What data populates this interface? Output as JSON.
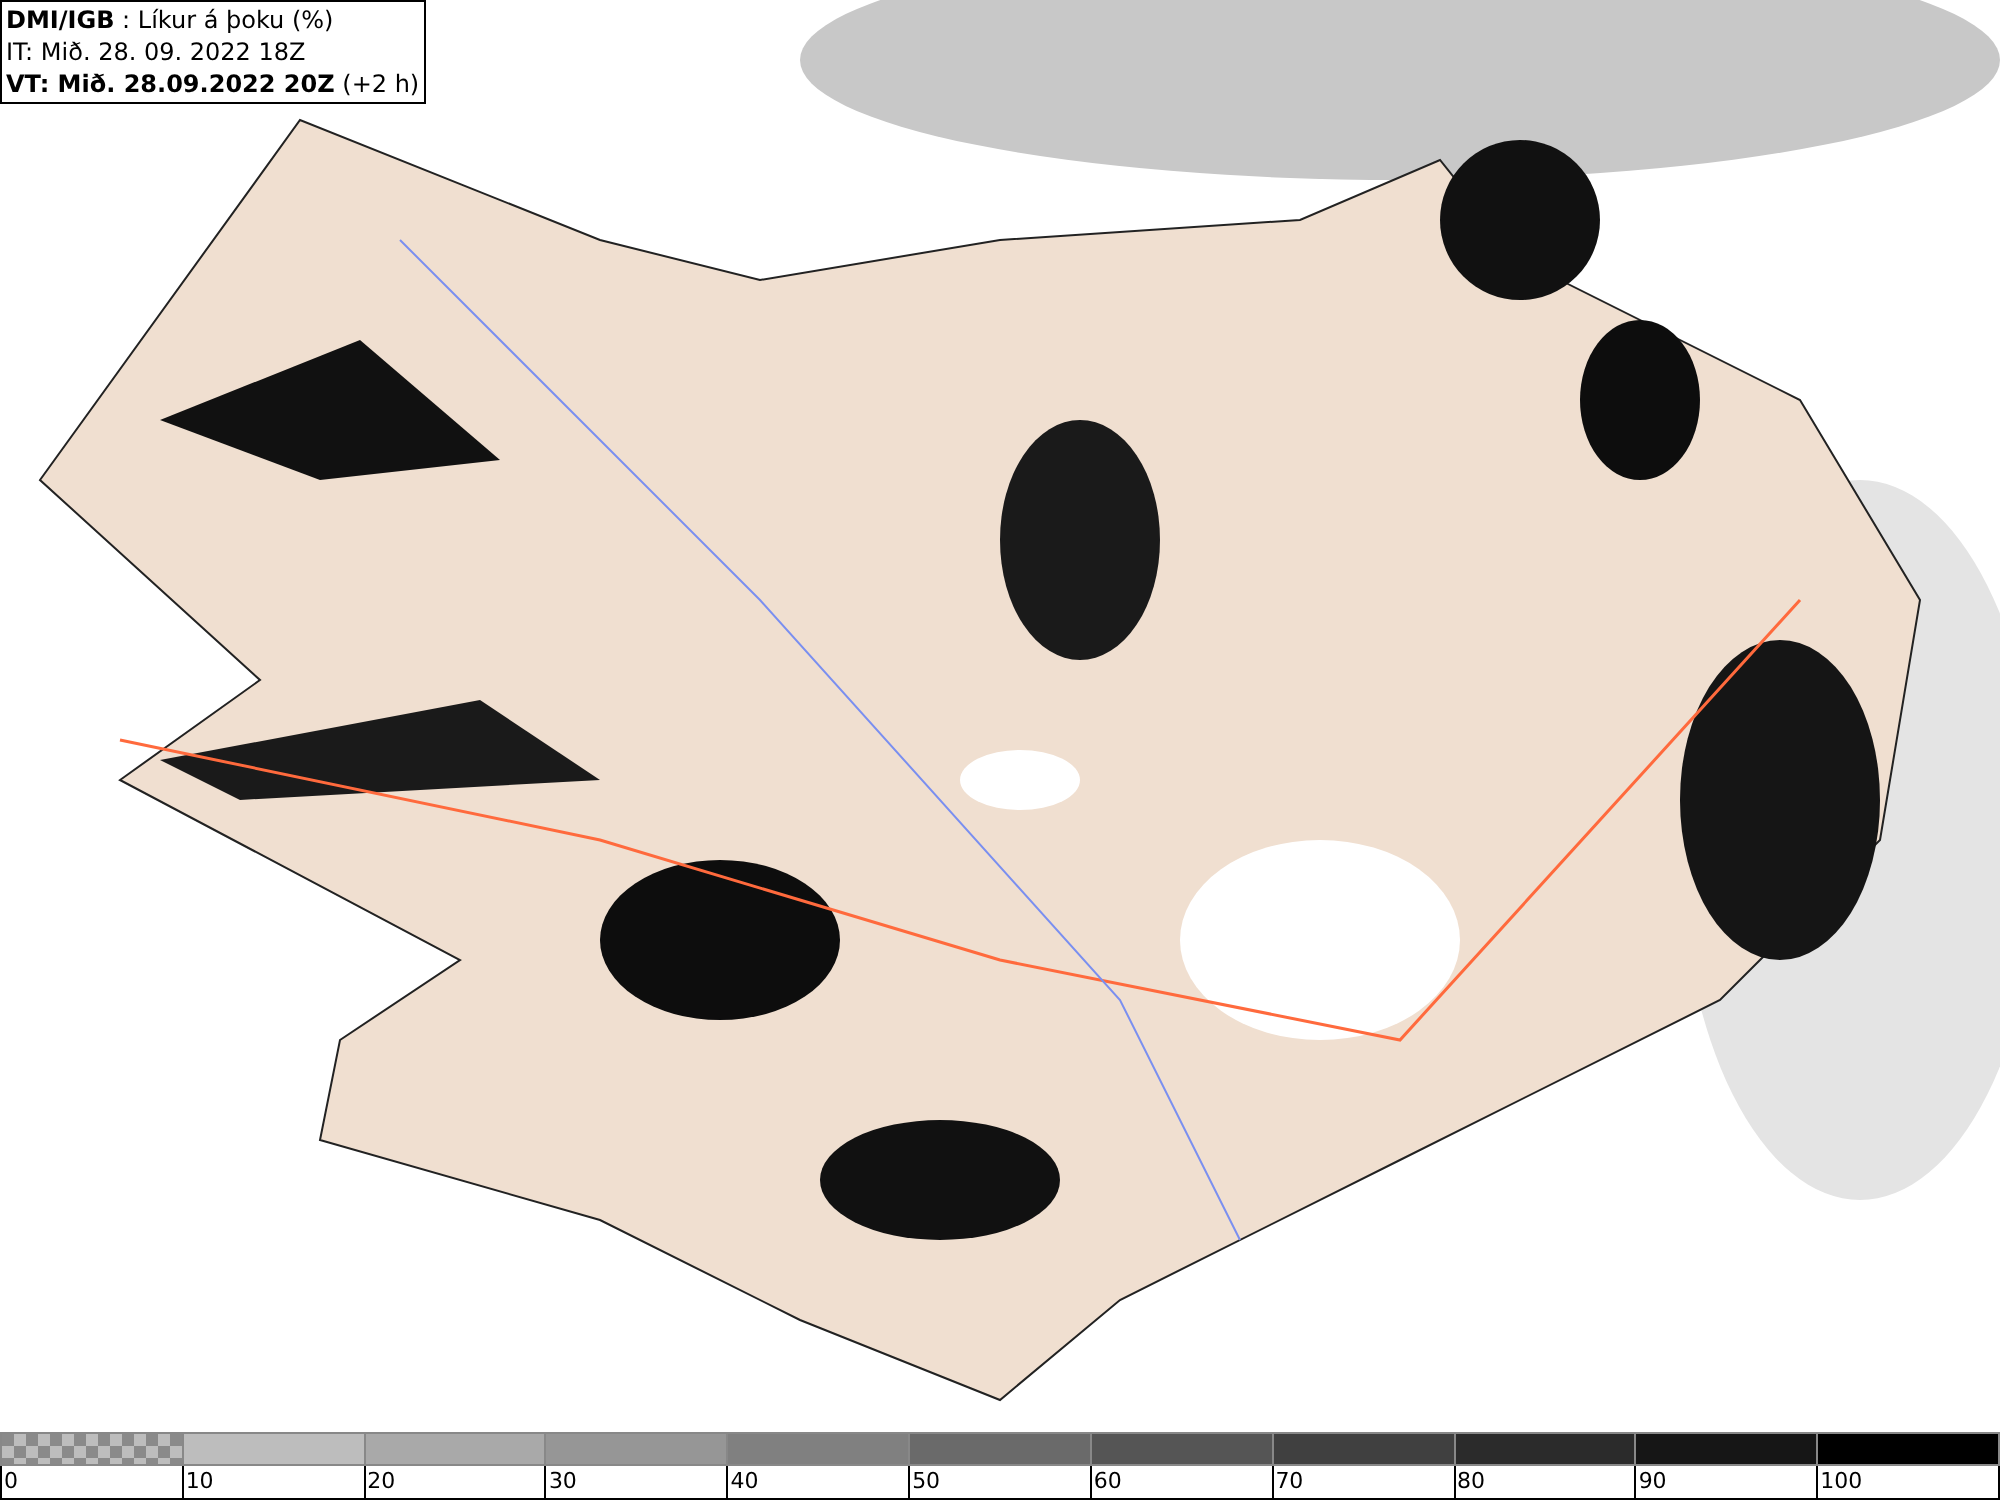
{
  "header": {
    "lines": [
      "**DMI/IGB** : Líkur á þoku (%)",
      "IT: Mið. 28. 09. 2022 18Z",
      "**VT: Mið. 28.09.2022 20Z** (+2 h)"
    ]
  },
  "legend": [
    {
      "label": "0",
      "kind": "checker",
      "color": "#8a8a8a"
    },
    {
      "label": "10",
      "kind": "solid",
      "color": "#bdbdbd"
    },
    {
      "label": "20",
      "kind": "solid",
      "color": "#a9a9a9"
    },
    {
      "label": "30",
      "kind": "solid",
      "color": "#969696"
    },
    {
      "label": "40",
      "kind": "solid",
      "color": "#808080"
    },
    {
      "label": "50",
      "kind": "solid",
      "color": "#6a6a6a"
    },
    {
      "label": "60",
      "kind": "solid",
      "color": "#555555"
    },
    {
      "label": "70",
      "kind": "solid",
      "color": "#404040"
    },
    {
      "label": "80",
      "kind": "solid",
      "color": "#2b2b2b"
    },
    {
      "label": "90",
      "kind": "solid",
      "color": "#161616"
    },
    {
      "label": "100",
      "kind": "solid",
      "color": "#000000"
    }
  ]
}
